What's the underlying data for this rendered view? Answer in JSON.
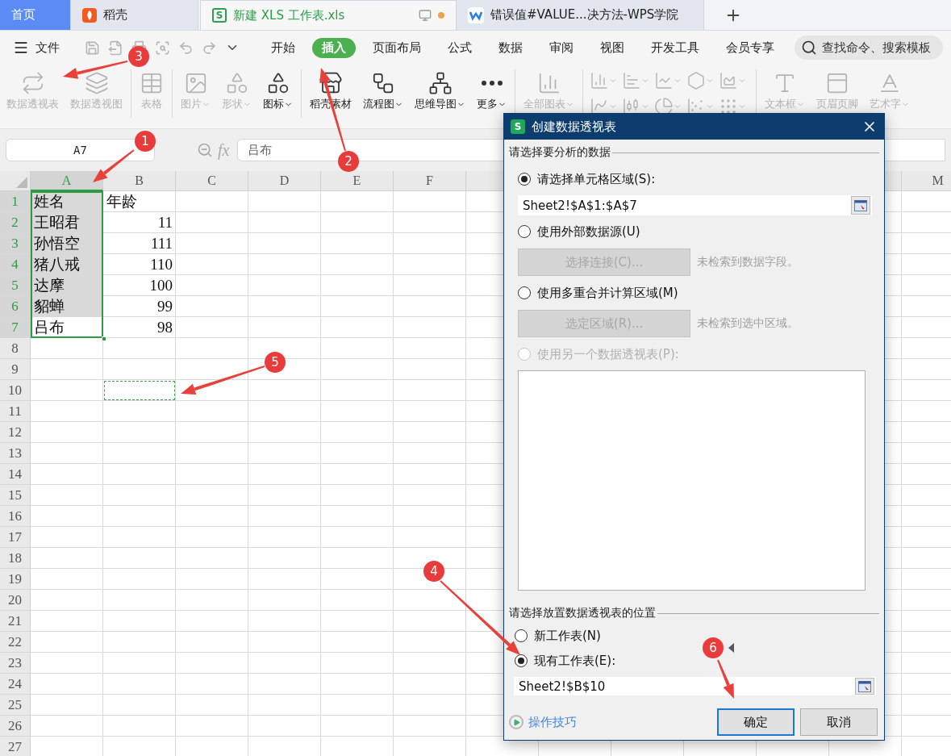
{
  "tabs": [
    {
      "label": "首页",
      "selected": false,
      "kind": "home"
    },
    {
      "label": "稻壳",
      "selected": false,
      "kind": "daoke"
    },
    {
      "label": "新建 XLS 工作表.xls",
      "selected": true,
      "kind": "sheet",
      "logo": "S"
    },
    {
      "label": "错误值#VALUE...决方法-WPS学院",
      "selected": false,
      "kind": "web"
    }
  ],
  "menu": {
    "file": "文件",
    "ribbon_tabs": [
      {
        "label": "开始",
        "selected": false
      },
      {
        "label": "插入",
        "selected": true
      },
      {
        "label": "页面布局",
        "selected": false
      },
      {
        "label": "公式",
        "selected": false
      },
      {
        "label": "数据",
        "selected": false
      },
      {
        "label": "审阅",
        "selected": false
      },
      {
        "label": "视图",
        "selected": false
      },
      {
        "label": "开发工具",
        "selected": false
      },
      {
        "label": "会员专享",
        "selected": false
      }
    ],
    "search": {
      "placeholder": "查找命令、搜索模板"
    }
  },
  "ribbon": {
    "groups": [
      {
        "kind": "large",
        "items": [
          {
            "label": "数据透视表",
            "disabled": true,
            "dropdown": false
          },
          {
            "label": "数据透视图",
            "disabled": true,
            "dropdown": false
          }
        ]
      },
      {
        "kind": "large",
        "items": [
          {
            "label": "表格",
            "disabled": true,
            "dropdown": false
          }
        ]
      },
      {
        "kind": "large",
        "items": [
          {
            "label": "图片",
            "disabled": true,
            "dropdown": true
          },
          {
            "label": "形状",
            "disabled": true,
            "dropdown": true
          },
          {
            "label": "图标",
            "disabled": false,
            "dropdown": true
          }
        ]
      },
      {
        "kind": "large",
        "items": [
          {
            "label": "稻壳素材",
            "disabled": false,
            "dropdown": false
          },
          {
            "label": "流程图",
            "disabled": false,
            "dropdown": true
          },
          {
            "label": "思维导图",
            "disabled": false,
            "dropdown": true
          },
          {
            "label": "更多",
            "disabled": false,
            "dropdown": true
          }
        ]
      },
      {
        "kind": "large",
        "items": [
          {
            "label": "全部图表",
            "disabled": true,
            "dropdown": true
          }
        ]
      },
      {
        "kind": "small",
        "items": [
          {
            "disabled": true,
            "dropdown": true
          },
          {
            "disabled": true,
            "dropdown": true
          },
          {
            "disabled": true,
            "dropdown": true
          },
          {
            "disabled": true,
            "dropdown": true
          },
          {
            "disabled": true,
            "dropdown": true
          },
          {
            "disabled": true,
            "dropdown": true
          },
          {
            "disabled": true,
            "dropdown": true
          },
          {
            "disabled": true,
            "dropdown": true
          },
          {
            "disabled": true,
            "dropdown": true
          },
          {
            "disabled": true,
            "dropdown": true
          }
        ]
      },
      {
        "kind": "large",
        "items": [
          {
            "label": "文本框",
            "disabled": true,
            "dropdown": true
          },
          {
            "label": "页眉页脚",
            "disabled": true,
            "dropdown": false
          },
          {
            "label": "艺术字",
            "disabled": true,
            "dropdown": true
          }
        ]
      }
    ]
  },
  "formula_bar": {
    "name_box": "A7",
    "fx": "fx",
    "value": "吕布"
  },
  "sheet": {
    "columns": [
      {
        "letter": "A",
        "selected": true
      },
      {
        "letter": "B",
        "selected": false
      },
      {
        "letter": "C",
        "selected": false
      },
      {
        "letter": "D",
        "selected": false
      },
      {
        "letter": "E",
        "selected": false
      },
      {
        "letter": "F",
        "selected": false
      },
      {
        "letter": "M",
        "selected": false
      }
    ],
    "rows": [
      {
        "header": "1",
        "selected": true,
        "active": false,
        "marquee": false,
        "cells": [
          {
            "text": "姓名",
            "kind": "text"
          },
          {
            "text": "年龄",
            "kind": "text"
          }
        ]
      },
      {
        "header": "2",
        "selected": true,
        "active": false,
        "marquee": false,
        "cells": [
          {
            "text": "王昭君",
            "kind": "text"
          },
          {
            "text": "11",
            "kind": "number"
          }
        ]
      },
      {
        "header": "3",
        "selected": true,
        "active": false,
        "marquee": false,
        "cells": [
          {
            "text": "孙悟空",
            "kind": "text"
          },
          {
            "text": "111",
            "kind": "number"
          }
        ]
      },
      {
        "header": "4",
        "selected": true,
        "active": false,
        "marquee": false,
        "cells": [
          {
            "text": "猪八戒",
            "kind": "text"
          },
          {
            "text": "110",
            "kind": "number"
          }
        ]
      },
      {
        "header": "5",
        "selected": true,
        "active": false,
        "marquee": false,
        "cells": [
          {
            "text": "达摩",
            "kind": "text"
          },
          {
            "text": "100",
            "kind": "number"
          }
        ]
      },
      {
        "header": "6",
        "selected": true,
        "active": false,
        "marquee": false,
        "cells": [
          {
            "text": "貂蝉",
            "kind": "text"
          },
          {
            "text": "99",
            "kind": "number"
          }
        ]
      },
      {
        "header": "7",
        "selected": true,
        "active": true,
        "marquee": false,
        "cells": [
          {
            "text": "吕布",
            "kind": "text"
          },
          {
            "text": "98",
            "kind": "number"
          }
        ]
      },
      {
        "header": "8",
        "selected": false,
        "active": false,
        "marquee": false
      },
      {
        "header": "9",
        "selected": false,
        "active": false,
        "marquee": false
      },
      {
        "header": "10",
        "selected": false,
        "active": false,
        "marquee": true
      },
      {
        "header": "11",
        "selected": false,
        "active": false,
        "marquee": false
      },
      {
        "header": "12",
        "selected": false,
        "active": false,
        "marquee": false
      },
      {
        "header": "13",
        "selected": false,
        "active": false,
        "marquee": false
      },
      {
        "header": "14",
        "selected": false,
        "active": false,
        "marquee": false
      },
      {
        "header": "15",
        "selected": false,
        "active": false,
        "marquee": false
      },
      {
        "header": "16",
        "selected": false,
        "active": false,
        "marquee": false
      },
      {
        "header": "17",
        "selected": false,
        "active": false,
        "marquee": false
      },
      {
        "header": "18",
        "selected": false,
        "active": false,
        "marquee": false
      },
      {
        "header": "19",
        "selected": false,
        "active": false,
        "marquee": false
      },
      {
        "header": "20",
        "selected": false,
        "active": false,
        "marquee": false
      },
      {
        "header": "21",
        "selected": false,
        "active": false,
        "marquee": false
      },
      {
        "header": "22",
        "selected": false,
        "active": false,
        "marquee": false
      },
      {
        "header": "23",
        "selected": false,
        "active": false,
        "marquee": false
      },
      {
        "header": "24",
        "selected": false,
        "active": false,
        "marquee": false
      },
      {
        "header": "25",
        "selected": false,
        "active": false,
        "marquee": false
      },
      {
        "header": "26",
        "selected": false,
        "active": false,
        "marquee": false
      },
      {
        "header": "27",
        "selected": false,
        "active": false,
        "marquee": false
      }
    ]
  },
  "dialog": {
    "logo": "S",
    "title": "创建数据透视表",
    "source": {
      "heading": "请选择要分析的数据",
      "options": [
        {
          "label": "请选择单元格区域(S):",
          "selected": true,
          "disabled": false,
          "kind": "field",
          "value": "Sheet2!$A$1:$A$7"
        },
        {
          "label": "使用外部数据源(U)",
          "selected": false,
          "disabled": false,
          "kind": "button",
          "button": "选择连接(C)...",
          "button_disabled": true,
          "note": "未检索到数据字段。"
        },
        {
          "label": "使用多重合并计算区域(M)",
          "selected": false,
          "disabled": false,
          "kind": "button",
          "button": "选定区域(R)...",
          "button_disabled": true,
          "note": "未检索到选中区域。"
        },
        {
          "label": "使用另一个数据透视表(P):",
          "selected": false,
          "disabled": true,
          "kind": "list"
        }
      ]
    },
    "destination": {
      "heading": "请选择放置数据透视表的位置",
      "options": [
        {
          "label": "新工作表(N)",
          "selected": false
        },
        {
          "label": "现有工作表(E):",
          "selected": true
        }
      ],
      "value": "Sheet2!$B$10"
    },
    "tips": "操作技巧",
    "buttons": [
      {
        "label": "确定",
        "default": true
      },
      {
        "label": "取消",
        "default": false
      }
    ]
  },
  "annotations": [
    {
      "number": "1"
    },
    {
      "number": "2"
    },
    {
      "number": "3"
    },
    {
      "number": "4"
    },
    {
      "number": "5"
    },
    {
      "number": "6"
    }
  ]
}
